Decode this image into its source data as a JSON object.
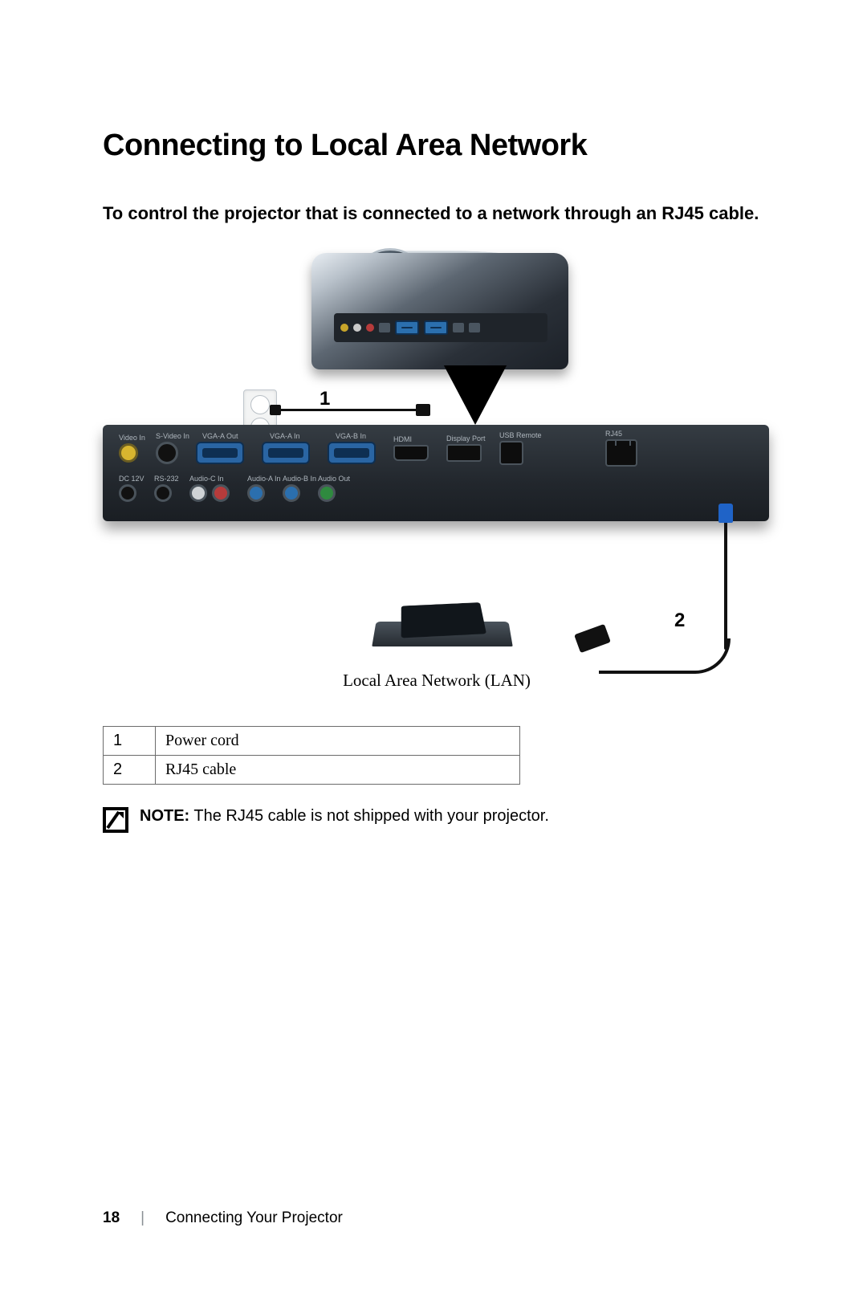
{
  "heading": "Connecting to Local Area Network",
  "lead": "To control the projector that is connected to a network through an RJ45 cable.",
  "diagram": {
    "callouts": {
      "1": "1",
      "2": "2"
    },
    "caption": "Local Area Network (LAN)",
    "port_labels": {
      "video_in": "Video In",
      "svideo_in": "S-Video In",
      "vga_a_out": "VGA-A Out",
      "vga_a_in": "VGA-A In",
      "vga_b_in": "VGA-B In",
      "hdmi": "HDMI",
      "display_port": "Display Port",
      "usb_remote": "USB Remote",
      "rj45": "RJ45",
      "rs232": "RS-232",
      "audio_c_in": "Audio-C In",
      "audio_a_in": "Audio-A In",
      "audio_b_in": "Audio-B In",
      "audio_out": "Audio Out",
      "dc12v": "DC 12V"
    }
  },
  "legend": [
    {
      "n": "1",
      "label": "Power cord"
    },
    {
      "n": "2",
      "label": "RJ45 cable"
    }
  ],
  "note": {
    "prefix": "NOTE:",
    "text": " The RJ45 cable is not shipped with your projector."
  },
  "footer": {
    "page": "18",
    "section": "Connecting Your Projector"
  }
}
